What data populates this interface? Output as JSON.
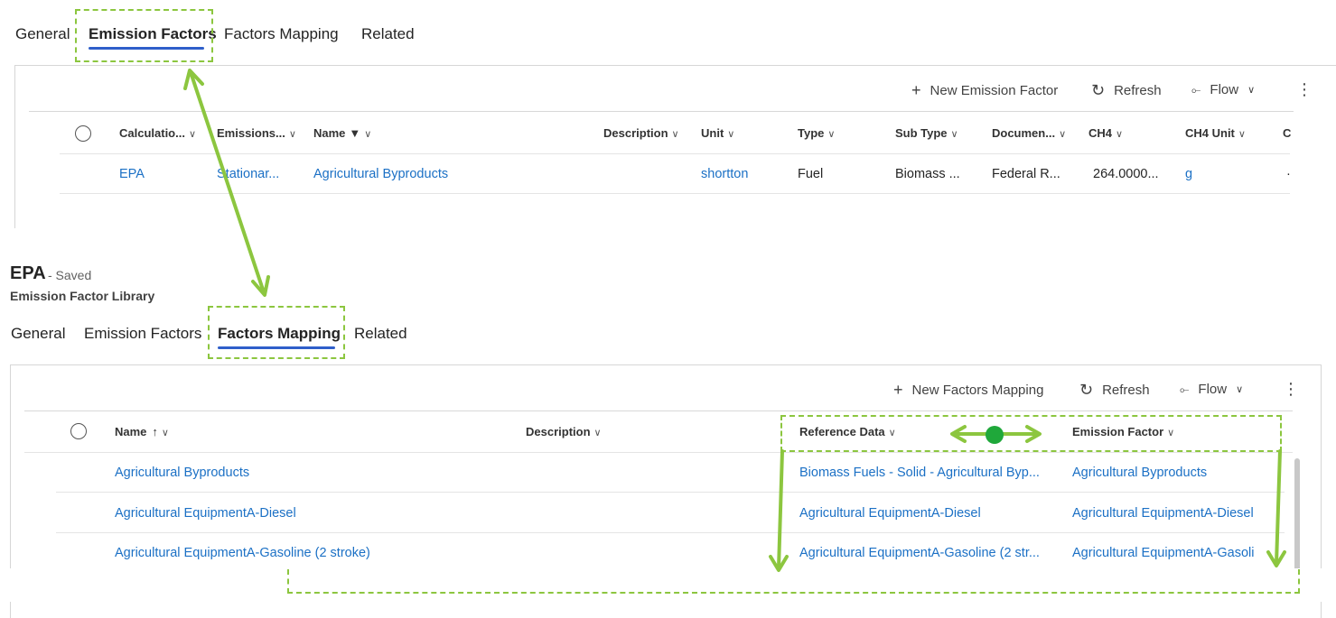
{
  "top": {
    "tabs": [
      "General",
      "Emission Factors",
      "Factors Mapping",
      "Related"
    ],
    "commands": {
      "new_label": "New Emission Factor",
      "refresh_label": "Refresh",
      "flow_label": "Flow"
    },
    "columns": [
      "Calculatio...",
      "Emissions...",
      "Name",
      "Description",
      "Unit",
      "Type",
      "Sub Type",
      "Documen...",
      "CH4",
      "CH4 Unit",
      "C"
    ],
    "row": {
      "calculation": "EPA",
      "emissions": "Stationar...",
      "name": "Agricultural Byproducts",
      "unit": "shortton",
      "type": "Fuel",
      "sub_type": "Biomass ...",
      "document": "Federal R...",
      "ch4": "264.0000...",
      "ch4_unit": "g",
      "c": "·"
    }
  },
  "record": {
    "title": "EPA",
    "status": "- Saved",
    "entity": "Emission Factor Library"
  },
  "bottom": {
    "tabs": [
      "General",
      "Emission Factors",
      "Factors Mapping",
      "Related"
    ],
    "commands": {
      "new_label": "New Factors Mapping",
      "refresh_label": "Refresh",
      "flow_label": "Flow"
    },
    "columns": [
      "Name",
      "Description",
      "Reference Data",
      "Emission Factor"
    ],
    "rows": [
      {
        "name": "Agricultural Byproducts",
        "reference": "Biomass Fuels - Solid - Agricultural Byp...",
        "factor": "Agricultural Byproducts"
      },
      {
        "name": "Agricultural EquipmentA-Diesel",
        "reference": "Agricultural EquipmentA-Diesel",
        "factor": "Agricultural EquipmentA-Diesel"
      },
      {
        "name": "Agricultural EquipmentA-Gasoline (2 stroke)",
        "reference": "Agricultural EquipmentA-Gasoline (2 str...",
        "factor": "Agricultural EquipmentA-Gasoli"
      }
    ]
  },
  "colors": {
    "accent": "#2f5fca",
    "link": "#1b70c5",
    "annotation": "#8cc63f",
    "annotation_dot": "#1fa83a"
  }
}
